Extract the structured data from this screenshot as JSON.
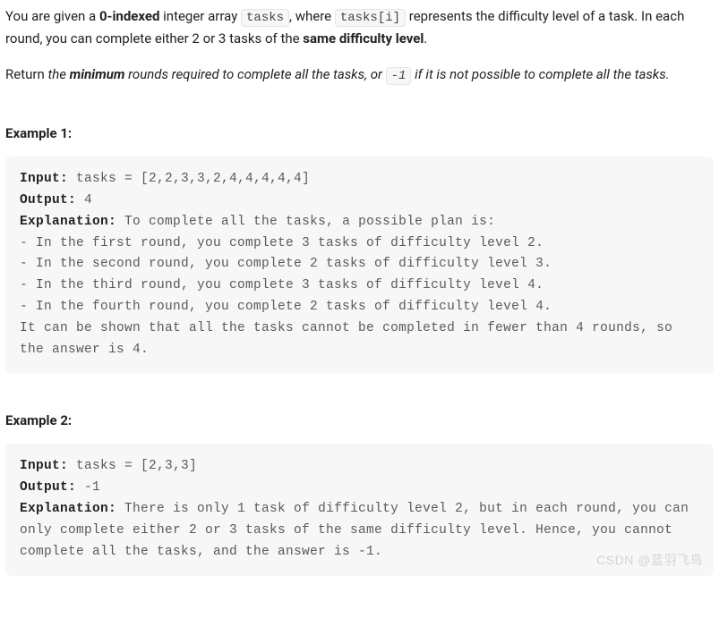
{
  "problem": {
    "p1_a": "You are given a ",
    "p1_b": "0-indexed",
    "p1_c": " integer array ",
    "p1_code1": "tasks",
    "p1_d": ", where ",
    "p1_code2": "tasks[i]",
    "p1_e": " represents the difficulty level of a task. In each round, you can complete either 2 or 3 tasks of the ",
    "p1_f": "same difficulty level",
    "p1_g": ".",
    "p2_a": "Return ",
    "p2_b": "the ",
    "p2_c": "minimum",
    "p2_d": " rounds required to complete all the tasks, or ",
    "p2_code1": "-1",
    "p2_e": " if it is not possible to complete all the tasks."
  },
  "example1": {
    "heading": "Example 1:",
    "input_label": "Input:",
    "input_value": " tasks = [2,2,3,3,2,4,4,4,4,4]",
    "output_label": "Output:",
    "output_value": " 4",
    "explanation_label": "Explanation:",
    "explanation_value": " To complete all the tasks, a possible plan is:\n- In the first round, you complete 3 tasks of difficulty level 2.\n- In the second round, you complete 2 tasks of difficulty level 3.\n- In the third round, you complete 3 tasks of difficulty level 4.\n- In the fourth round, you complete 2 tasks of difficulty level 4.\nIt can be shown that all the tasks cannot be completed in fewer than 4 rounds, so the answer is 4."
  },
  "example2": {
    "heading": "Example 2:",
    "input_label": "Input:",
    "input_value": " tasks = [2,3,3]",
    "output_label": "Output:",
    "output_value": " -1",
    "explanation_label": "Explanation:",
    "explanation_value": " There is only 1 task of difficulty level 2, but in each round, you can only complete either 2 or 3 tasks of the same difficulty level. Hence, you cannot complete all the tasks, and the answer is -1."
  },
  "watermark": "CSDN @蓝羽飞鸟"
}
